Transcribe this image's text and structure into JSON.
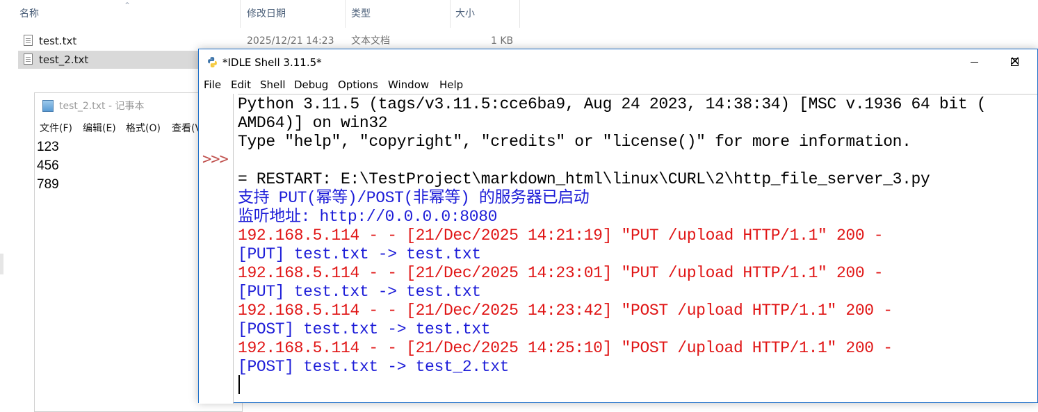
{
  "explorer": {
    "columns": {
      "name": "名称",
      "modified": "修改日期",
      "type": "类型",
      "size": "大小"
    },
    "files": [
      {
        "name": "test.txt",
        "modified": "2025/12/21 14:23",
        "type": "文本文档",
        "size": "1 KB"
      },
      {
        "name": "test_2.txt"
      }
    ]
  },
  "notepad": {
    "title": "test_2.txt - 记事本",
    "menu": [
      "文件(F)",
      "编辑(E)",
      "格式(O)",
      "查看(V"
    ],
    "lines": [
      "123",
      "456",
      "789"
    ]
  },
  "idle": {
    "title": "*IDLE Shell 3.11.5*",
    "menu": [
      "File",
      "Edit",
      "Shell",
      "Debug",
      "Options",
      "Window",
      "Help"
    ],
    "prompt": ">>>",
    "lines": [
      {
        "text": "Python 3.11.5 (tags/v3.11.5:cce6ba9, Aug 24 2023, 14:38:34) [MSC v.1936 64 bit (",
        "color": "black"
      },
      {
        "text": "AMD64)] on win32",
        "color": "black"
      },
      {
        "text": "Type \"help\", \"copyright\", \"credits\" or \"license()\" for more information.",
        "color": "black"
      },
      {
        "text": "= RESTART: E:\\TestProject\\markdown_html\\linux\\CURL\\2\\http_file_server_3.py",
        "color": "black"
      },
      {
        "text": "支持 PUT(幂等)/POST(非幂等) 的服务器已启动",
        "color": "blue"
      },
      {
        "text": "监听地址: http://0.0.0.0:8080",
        "color": "blue"
      },
      {
        "text": "192.168.5.114 - - [21/Dec/2025 14:21:19] \"PUT /upload HTTP/1.1\" 200 -",
        "color": "red"
      },
      {
        "text": "[PUT] test.txt -> test.txt",
        "color": "blue"
      },
      {
        "text": "192.168.5.114 - - [21/Dec/2025 14:23:01] \"PUT /upload HTTP/1.1\" 200 -",
        "color": "red"
      },
      {
        "text": "[PUT] test.txt -> test.txt",
        "color": "blue"
      },
      {
        "text": "192.168.5.114 - - [21/Dec/2025 14:23:42] \"POST /upload HTTP/1.1\" 200 -",
        "color": "red"
      },
      {
        "text": "[POST] test.txt -> test.txt",
        "color": "blue"
      },
      {
        "text": "192.168.5.114 - - [21/Dec/2025 14:25:10] \"POST /upload HTTP/1.1\" 200 -",
        "color": "red"
      },
      {
        "text": "[POST] test.txt -> test_2.txt",
        "color": "blue"
      }
    ]
  },
  "colors": {
    "stdout_blue": "#1d1dd8",
    "stderr_red": "#e01515",
    "prompt_red": "#c0504d",
    "selection_gray": "#d9d9d9"
  },
  "icons": {
    "file": "text-file-icon",
    "notepad": "notepad-icon",
    "python": "python-icon",
    "minimize": "minimize-icon",
    "maximize": "maximize-icon",
    "close": "close-icon",
    "sort": "sort-up-arrow-icon"
  }
}
